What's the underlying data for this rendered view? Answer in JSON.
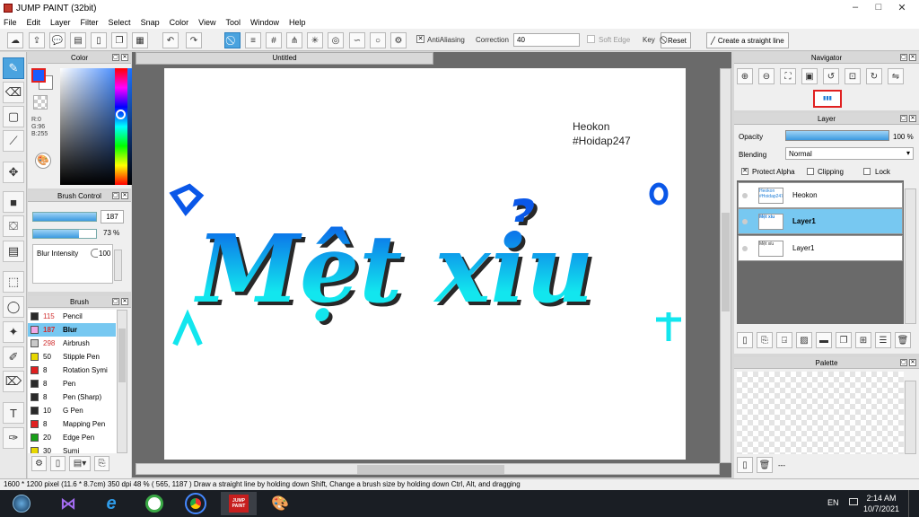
{
  "app": {
    "title": "JUMP PAINT (32bit)"
  },
  "window_controls": [
    "–",
    "□",
    "✕"
  ],
  "menu": [
    "File",
    "Edit",
    "Layer",
    "Filter",
    "Select",
    "Snap",
    "Color",
    "View",
    "Tool",
    "Window",
    "Help"
  ],
  "toolbar": {
    "antialiasing_label": "AntiAliasing",
    "correction_label": "Correction",
    "correction_value": "40",
    "soft_edge_label": "Soft Edge",
    "key_label": "Key",
    "reset_label": "Reset",
    "straight_line_label": "Create a straight line"
  },
  "color_panel": {
    "title": "Color",
    "r": "R:0",
    "g": "G:96",
    "b": "B:255",
    "primary_color": "#1a5cff",
    "secondary_color": "#ffffff"
  },
  "brush_control": {
    "title": "Brush Control",
    "size_value": "187",
    "opacity_value": "73 %",
    "blur_label": "Blur Intensity",
    "blur_value": "100"
  },
  "brush_panel": {
    "title": "Brush",
    "items": [
      {
        "size": "115",
        "name": "Pencil",
        "color": "#2a2a2a",
        "size_color": "#d03030"
      },
      {
        "size": "187",
        "name": "Blur",
        "color": "#f0a8e6",
        "size_color": "#d03030",
        "selected": true
      },
      {
        "size": "298",
        "name": "Airbrush",
        "color": "#c8c8c8",
        "size_color": "#d03030"
      },
      {
        "size": "50",
        "name": "Stipple Pen",
        "color": "#e8d800",
        "size_color": "#000000"
      },
      {
        "size": "8",
        "name": "Rotation Symi",
        "color": "#e02020",
        "size_color": "#000000"
      },
      {
        "size": "8",
        "name": "Pen",
        "color": "#2a2a2a",
        "size_color": "#000000"
      },
      {
        "size": "8",
        "name": "Pen (Sharp)",
        "color": "#2a2a2a",
        "size_color": "#000000"
      },
      {
        "size": "10",
        "name": "G Pen",
        "color": "#2a2a2a",
        "size_color": "#000000"
      },
      {
        "size": "8",
        "name": "Mapping Pen",
        "color": "#e02020",
        "size_color": "#000000"
      },
      {
        "size": "20",
        "name": "Edge Pen",
        "color": "#18a018",
        "size_color": "#000000"
      },
      {
        "size": "30",
        "name": "Sumi",
        "color": "#e8d800",
        "size_color": "#000000"
      }
    ]
  },
  "document": {
    "tab_title": "Untitled",
    "signature_name": "Heokon",
    "signature_tag": "#Hoidap247",
    "artwork_text": "Mệt xỉu"
  },
  "navigator": {
    "title": "Navigator"
  },
  "layer_panel": {
    "title": "Layer",
    "opacity_label": "Opacity",
    "opacity_value": "100 %",
    "opacity_fraction": 1.0,
    "blending_label": "Blending",
    "blending_value": "Normal",
    "protect_alpha_label": "Protect Alpha",
    "clipping_label": "Clipping",
    "lock_label": "Lock",
    "layers": [
      {
        "name": "Heokon",
        "selected": false
      },
      {
        "name": "Layer1",
        "selected": true
      },
      {
        "name": "Layer1",
        "selected": false
      }
    ]
  },
  "palette": {
    "title": "Palette",
    "dots": "---"
  },
  "status": {
    "size": "1600 * 1200 pixel",
    "dims": "(11.6 * 8.7cm)",
    "dpi": "350 dpi",
    "zoom": "48 %",
    "coords": "( 565, 1187 )",
    "hint": "Draw a straight line by holding down Shift, Change a brush size by holding down Ctrl, Alt, and dragging"
  },
  "taskbar": {
    "lang": "EN",
    "time": "2:14 AM",
    "date": "10/7/2021",
    "jumpaint_label": "JUMP PAINT"
  },
  "colors": {
    "accent": "#4aa3df",
    "selected_layer": "#77c8f1",
    "text_gradient_top": "#0a57e8",
    "text_gradient_bottom": "#12e6ee"
  }
}
